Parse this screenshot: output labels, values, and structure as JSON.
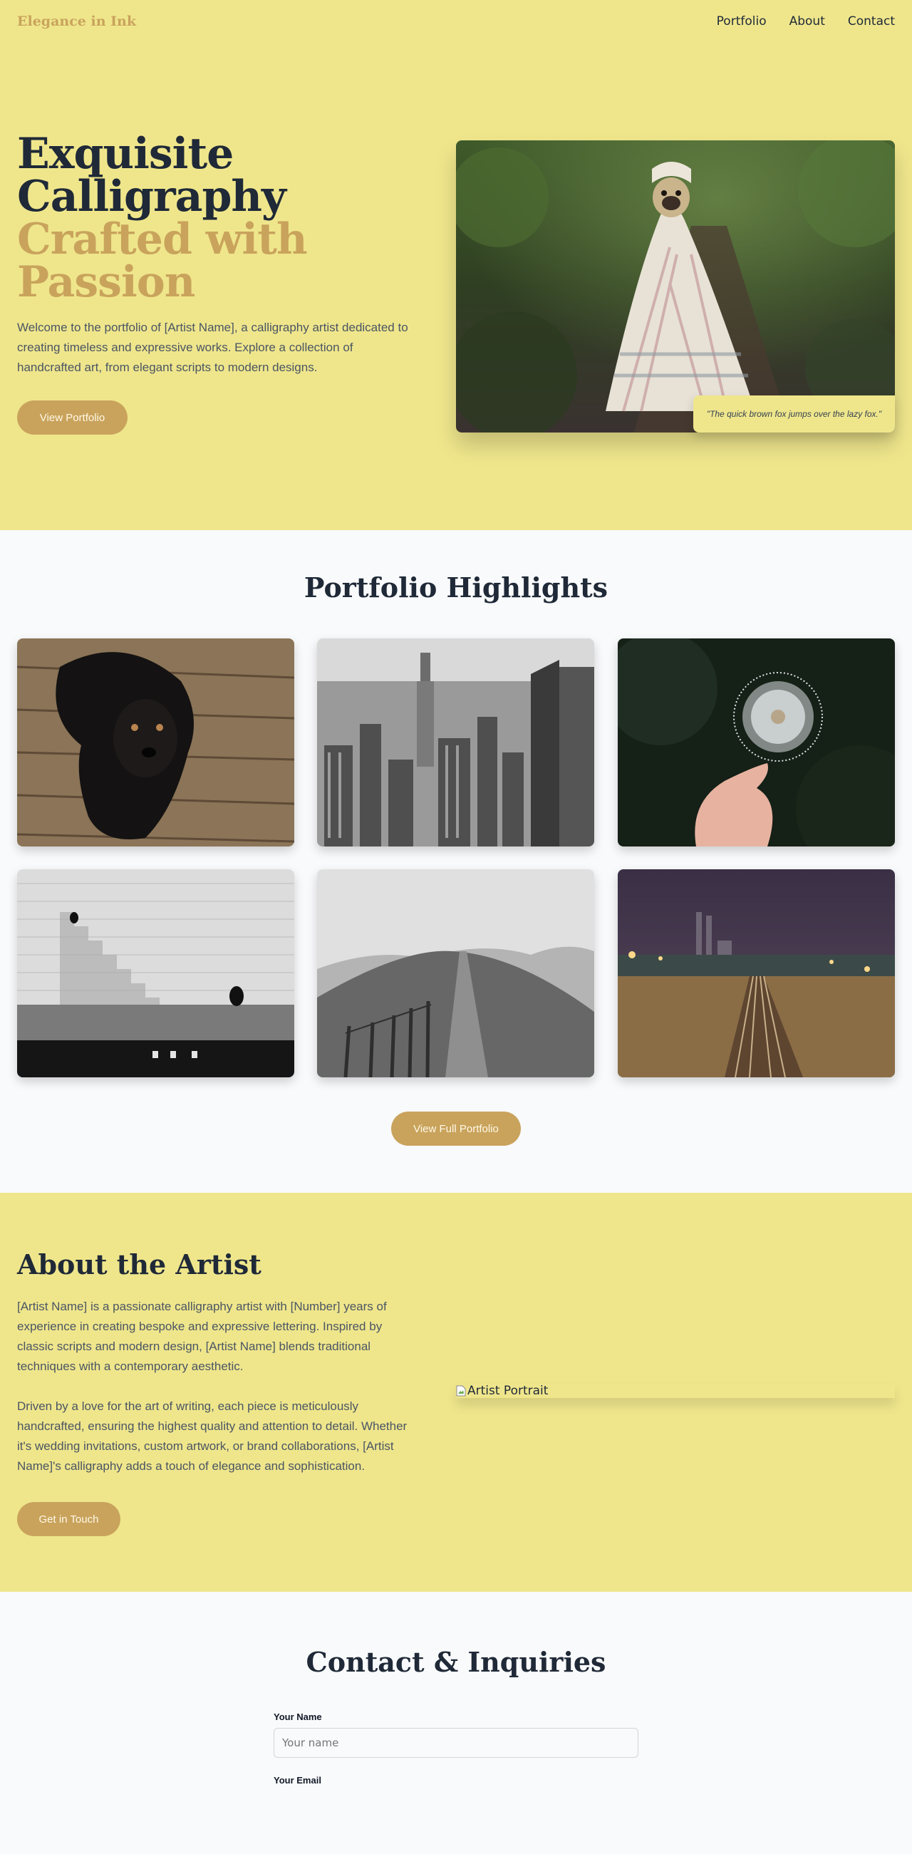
{
  "nav": {
    "logo": "Elegance in Ink",
    "links": [
      "Portfolio",
      "About",
      "Contact"
    ]
  },
  "hero": {
    "title_line1": "Exquisite",
    "title_line2": "Calligraphy",
    "title_line3": "Crafted with",
    "title_line4": "Passion",
    "text": "Welcome to the portfolio of [Artist Name], a calligraphy artist dedicated to creating timeless and expressive works. Explore a collection of handcrafted art, from elegant scripts to modern designs.",
    "button": "View Portfolio",
    "quote": "\"The quick brown fox jumps over the lazy fox.\""
  },
  "portfolio": {
    "title": "Portfolio Highlights",
    "button": "View Full Portfolio"
  },
  "about": {
    "title": "About the Artist",
    "paragraph1": "[Artist Name] is a passionate calligraphy artist with [Number] years of experience in creating bespoke and expressive lettering. Inspired by classic scripts and modern design, [Artist Name] blends traditional techniques with a contemporary aesthetic.",
    "paragraph2": "Driven by a love for the art of writing, each piece is meticulously handcrafted, ensuring the highest quality and attention to detail. Whether it's wedding invitations, custom artwork, or brand collaborations, [Artist Name]'s calligraphy adds a touch of elegance and sophistication.",
    "button": "Get in Touch",
    "portrait_alt": "Artist Portrait"
  },
  "contact": {
    "title": "Contact & Inquiries",
    "name_label": "Your Name",
    "name_placeholder": "Your name",
    "email_label": "Your Email"
  },
  "colors": {
    "accent_gold": "#c9a35c",
    "section_yellow": "#efe68c",
    "light_bg": "#f9fafb",
    "text_dark": "#1f2937"
  }
}
